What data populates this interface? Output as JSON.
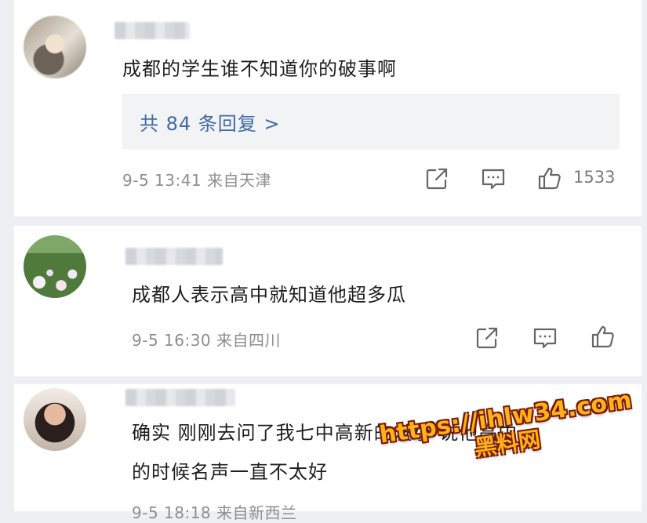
{
  "comments": [
    {
      "text": "成都的学生谁不知道你的破事啊",
      "replies_label": "共 84 条回复 >",
      "time": "9-5 13:41",
      "location": "来自天津",
      "like_count": "1533"
    },
    {
      "text": "成都人表示高中就知道他超多瓜",
      "time": "9-5 16:30",
      "location": "来自四川"
    },
    {
      "text_line1": "确实 刚刚去问了我七中高新的发小 说他高中",
      "text_line2": "的时候名声一直不太好",
      "meta_partial": "9-5 18:18 来自新西兰"
    }
  ],
  "watermark": {
    "url": "https://ihlw34.com",
    "name": "黑料网"
  },
  "icons": [
    "share-icon",
    "comment-icon",
    "like-icon"
  ],
  "colors": {
    "link_blue": "#3f6aa5",
    "meta_gray": "#8e8e8e",
    "watermark_orange": "#ffb21a"
  }
}
